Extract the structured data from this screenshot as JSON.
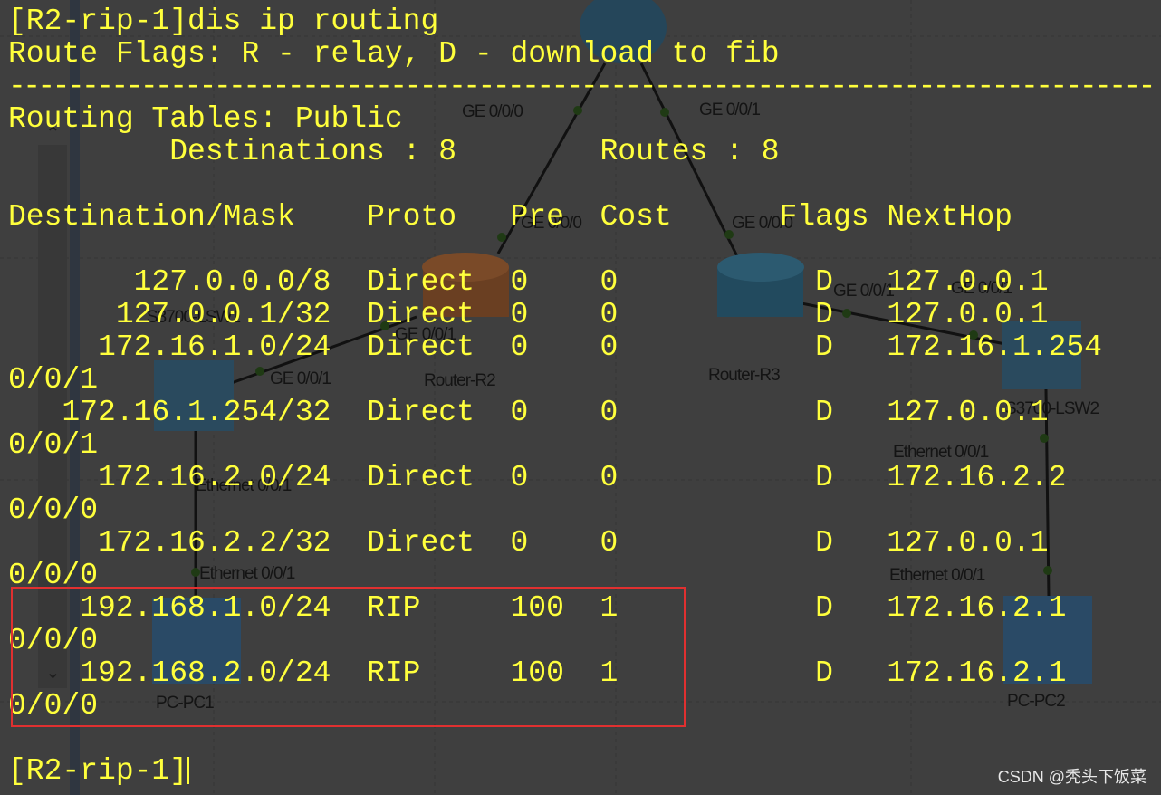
{
  "terminal": {
    "command_line": "[R2-rip-1]dis ip routing",
    "flags_line": "Route Flags: R - relay, D - download to fib",
    "separator": "------------------------------------------------------------------------------",
    "table_title": "Routing Tables: Public",
    "destinations_label": "Destinations : 8",
    "routes_label": "Routes : 8",
    "headers": [
      "Destination/Mask",
      "Proto",
      "Pre",
      "Cost",
      "Flags",
      "NextHop"
    ],
    "rows": [
      {
        "dest": "127.0.0.0/8",
        "proto": "Direct",
        "pre": "0",
        "cost": "0",
        "flags": "D",
        "nexthop": "127.0.0.1",
        "iface": ""
      },
      {
        "dest": "127.0.0.1/32",
        "proto": "Direct",
        "pre": "0",
        "cost": "0",
        "flags": "D",
        "nexthop": "127.0.0.1",
        "iface": ""
      },
      {
        "dest": "172.16.1.0/24",
        "proto": "Direct",
        "pre": "0",
        "cost": "0",
        "flags": "D",
        "nexthop": "172.16.1.254",
        "iface": "0/0/1"
      },
      {
        "dest": "172.16.1.254/32",
        "proto": "Direct",
        "pre": "0",
        "cost": "0",
        "flags": "D",
        "nexthop": "127.0.0.1",
        "iface": "0/0/1"
      },
      {
        "dest": "172.16.2.0/24",
        "proto": "Direct",
        "pre": "0",
        "cost": "0",
        "flags": "D",
        "nexthop": "172.16.2.2",
        "iface": "0/0/0"
      },
      {
        "dest": "172.16.2.2/32",
        "proto": "Direct",
        "pre": "0",
        "cost": "0",
        "flags": "D",
        "nexthop": "127.0.0.1",
        "iface": "0/0/0"
      },
      {
        "dest": "192.168.1.0/24",
        "proto": "RIP",
        "pre": "100",
        "cost": "1",
        "flags": "D",
        "nexthop": "172.16.2.1",
        "iface": "0/0/0"
      },
      {
        "dest": "192.168.2.0/24",
        "proto": "RIP",
        "pre": "100",
        "cost": "1",
        "flags": "D",
        "nexthop": "172.16.2.1",
        "iface": "0/0/0"
      }
    ],
    "prompt": "[R2-rip-1]",
    "highlight_color": "#e03030",
    "text_color": "#ffff3c"
  },
  "topology": {
    "labels": {
      "r1_ge000": "GE 0/0/0",
      "r1_ge001": "GE 0/0/1",
      "r2_ge000": "GE 0/0/0",
      "r2_ge001": "GE 0/0/1",
      "r3_ge000": "GE 0/0/0",
      "r3_ge001": "GE 0/0/1",
      "sw1_ge001": "GE 0/0/1",
      "sw2_ge001": "GE 0/0/1",
      "sw1_name": "S3700-LSW1",
      "sw2_name": "S3700-LSW2",
      "r2_name": "Router-R2",
      "r3_name": "Router-R3",
      "sw1_eth": "Ethernet 0/0/1",
      "pc1_eth": "Ethernet 0/0/1",
      "sw2_eth": "Ethernet 0/0/1",
      "pc2_eth": "Ethernet 0/0/1",
      "pc1_name": "PC-PC1",
      "pc2_name": "PC-PC2"
    }
  },
  "watermark": "CSDN @秃头下饭菜"
}
